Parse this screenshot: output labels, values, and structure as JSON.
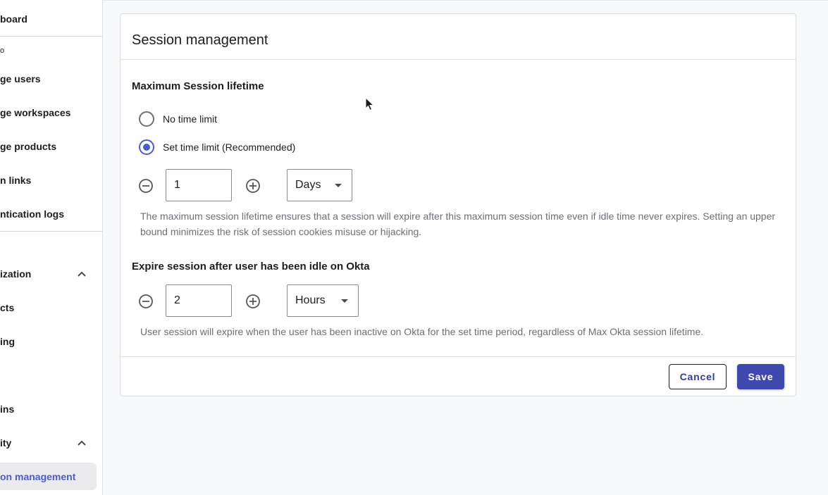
{
  "sidebar": {
    "items": [
      {
        "label": "board"
      },
      {
        "label": "o"
      },
      {
        "label": "ge users"
      },
      {
        "label": "ge workspaces"
      },
      {
        "label": "ge products"
      },
      {
        "label": "n links"
      },
      {
        "label": "ntication logs"
      },
      {
        "label": "ization"
      },
      {
        "label": "cts"
      },
      {
        "label": "ing"
      },
      {
        "label": "ins"
      },
      {
        "label": "ity"
      },
      {
        "label": "on management"
      }
    ]
  },
  "card": {
    "title": "Session management",
    "max_lifetime": {
      "heading": "Maximum Session lifetime",
      "options": [
        {
          "label": "No time limit",
          "checked": false
        },
        {
          "label": "Set time limit (Recommended)",
          "checked": true
        }
      ],
      "value": "1",
      "unit": "Days",
      "help": "The maximum session lifetime ensures that a session will expire after this maximum session time even if idle time never expires. Setting an upper bound minimizes the risk of session cookies misuse or hijacking."
    },
    "idle": {
      "heading": "Expire session after user has been idle on Okta",
      "value": "2",
      "unit": "Hours",
      "help": "User session will expire when the user has been inactive on Okta for the set time period, regardless of Max Okta session lifetime."
    },
    "buttons": {
      "cancel": "Cancel",
      "save": "Save"
    }
  },
  "colors": {
    "accent": "#4b5bd1",
    "save_bg": "#3f48ad"
  },
  "icons": [
    "chevron-up-icon",
    "minus-circle-icon",
    "plus-circle-icon",
    "caret-down-icon",
    "mouse-pointer-icon"
  ]
}
